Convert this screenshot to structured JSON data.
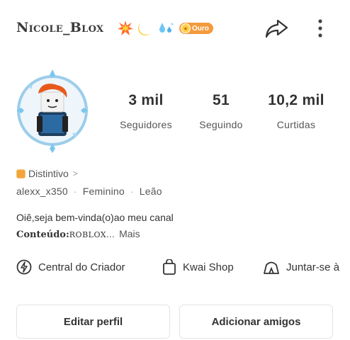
{
  "header": {
    "username": "Nicole_Blox",
    "badge_label": "Ouro",
    "icons": [
      "collision-emoji",
      "moon-emoji",
      "droplets-emoji",
      "share-icon",
      "more-icon"
    ]
  },
  "profile": {
    "avatar": "avatar-icon"
  },
  "stats": [
    {
      "value": "3 mil",
      "label": "Seguidores"
    },
    {
      "value": "51",
      "label": "Seguindo"
    },
    {
      "value": "10,2 mil",
      "label": "Curtidas"
    }
  ],
  "distintivo": {
    "label": "Distintivo",
    "chevron": ">"
  },
  "meta": {
    "handle": "alexx_x350",
    "gender": "Feminino",
    "sign": "Leão",
    "separator": "·"
  },
  "bio": {
    "line1": "Oiê,seja bem-vinda(o)ao meu canal",
    "content_label": "Conteúdo:",
    "content_value": "ROBLOX...",
    "more": "Mais"
  },
  "links": [
    {
      "label": "Central do Criador",
      "icon": "lightning-circle-icon"
    },
    {
      "label": "Kwai Shop",
      "icon": "shopping-bag-icon"
    },
    {
      "label": "Juntar-se à",
      "icon": "tent-icon"
    }
  ],
  "buttons": {
    "edit": "Editar perfil",
    "add": "Adicionar amigos"
  },
  "colors": {
    "badge": "#f39a3c",
    "text": "#333333",
    "muted": "#555555"
  }
}
